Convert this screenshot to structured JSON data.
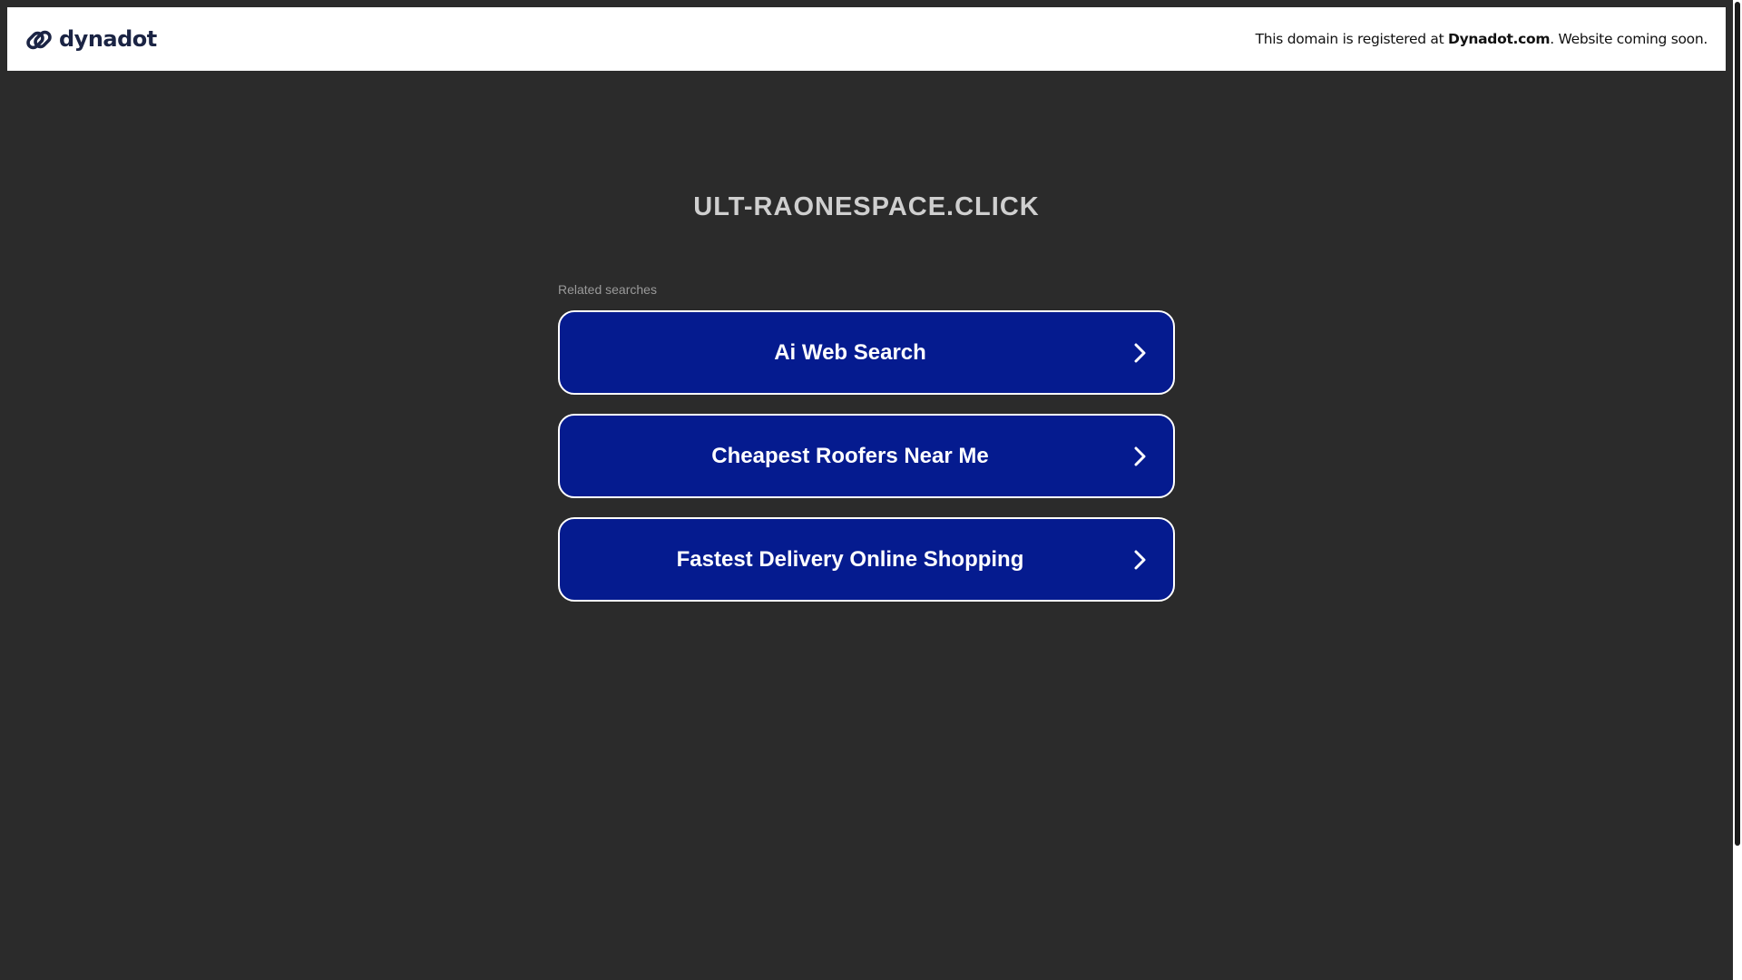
{
  "header": {
    "logo_text": "dynadot",
    "logo_icon": "dynadot-link-icon",
    "registered_prefix": "This domain is registered at ",
    "registered_brand": "Dynadot.com",
    "registered_suffix": ". Website coming soon."
  },
  "main": {
    "domain": "ULT-RAONESPACE.CLICK",
    "related_label": "Related searches",
    "results": [
      {
        "label": "Ai Web Search",
        "icon": "chevron-right-icon"
      },
      {
        "label": "Cheapest Roofers Near Me",
        "icon": "chevron-right-icon"
      },
      {
        "label": "Fastest Delivery Online Shopping",
        "icon": "chevron-right-icon"
      }
    ]
  },
  "colors": {
    "background": "#2b2b2b",
    "button": "#051b8f",
    "button_border": "#ffffff",
    "title": "#cfcfcf",
    "logo": "#1b2444"
  }
}
